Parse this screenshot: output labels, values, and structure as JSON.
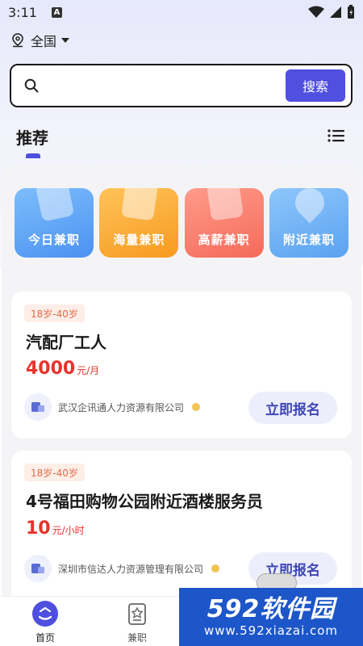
{
  "status_bar": {
    "time": "3:11",
    "notif_letter": "A"
  },
  "location": {
    "label": "全国"
  },
  "search": {
    "placeholder": "",
    "button_label": "搜索"
  },
  "section": {
    "title": "推荐"
  },
  "categories": [
    {
      "label": "今日兼职",
      "color": "#5aa0f5"
    },
    {
      "label": "海量兼职",
      "color": "#f9a52d"
    },
    {
      "label": "高薪兼职",
      "color": "#f67b6a"
    },
    {
      "label": "附近兼职",
      "color": "#66aaf2"
    }
  ],
  "jobs": [
    {
      "age_tag": "18岁-40岁",
      "title": "汽配厂工人",
      "salary": "4000",
      "salary_unit": "元/月",
      "company": "武汉企讯通人力资源有限公司",
      "apply_label": "立即报名"
    },
    {
      "age_tag": "18岁-40岁",
      "title": "4号福田购物公园附近酒楼服务员",
      "salary": "10",
      "salary_unit": "元/小时",
      "company": "深圳市信达人力资源管理有限公司",
      "apply_label": "立即报名"
    }
  ],
  "tabbar": {
    "items": [
      {
        "label": "首页",
        "active": true
      },
      {
        "label": "兼职",
        "active": false
      }
    ]
  },
  "watermark": {
    "main": "592软件园",
    "url": "www.592xiazai.com"
  },
  "colors": {
    "accent": "#4f4fe0",
    "salary": "#e8342c",
    "tag_text": "#e36a48",
    "tag_bg": "#fdeee8",
    "apply_bg": "#eceefb"
  }
}
